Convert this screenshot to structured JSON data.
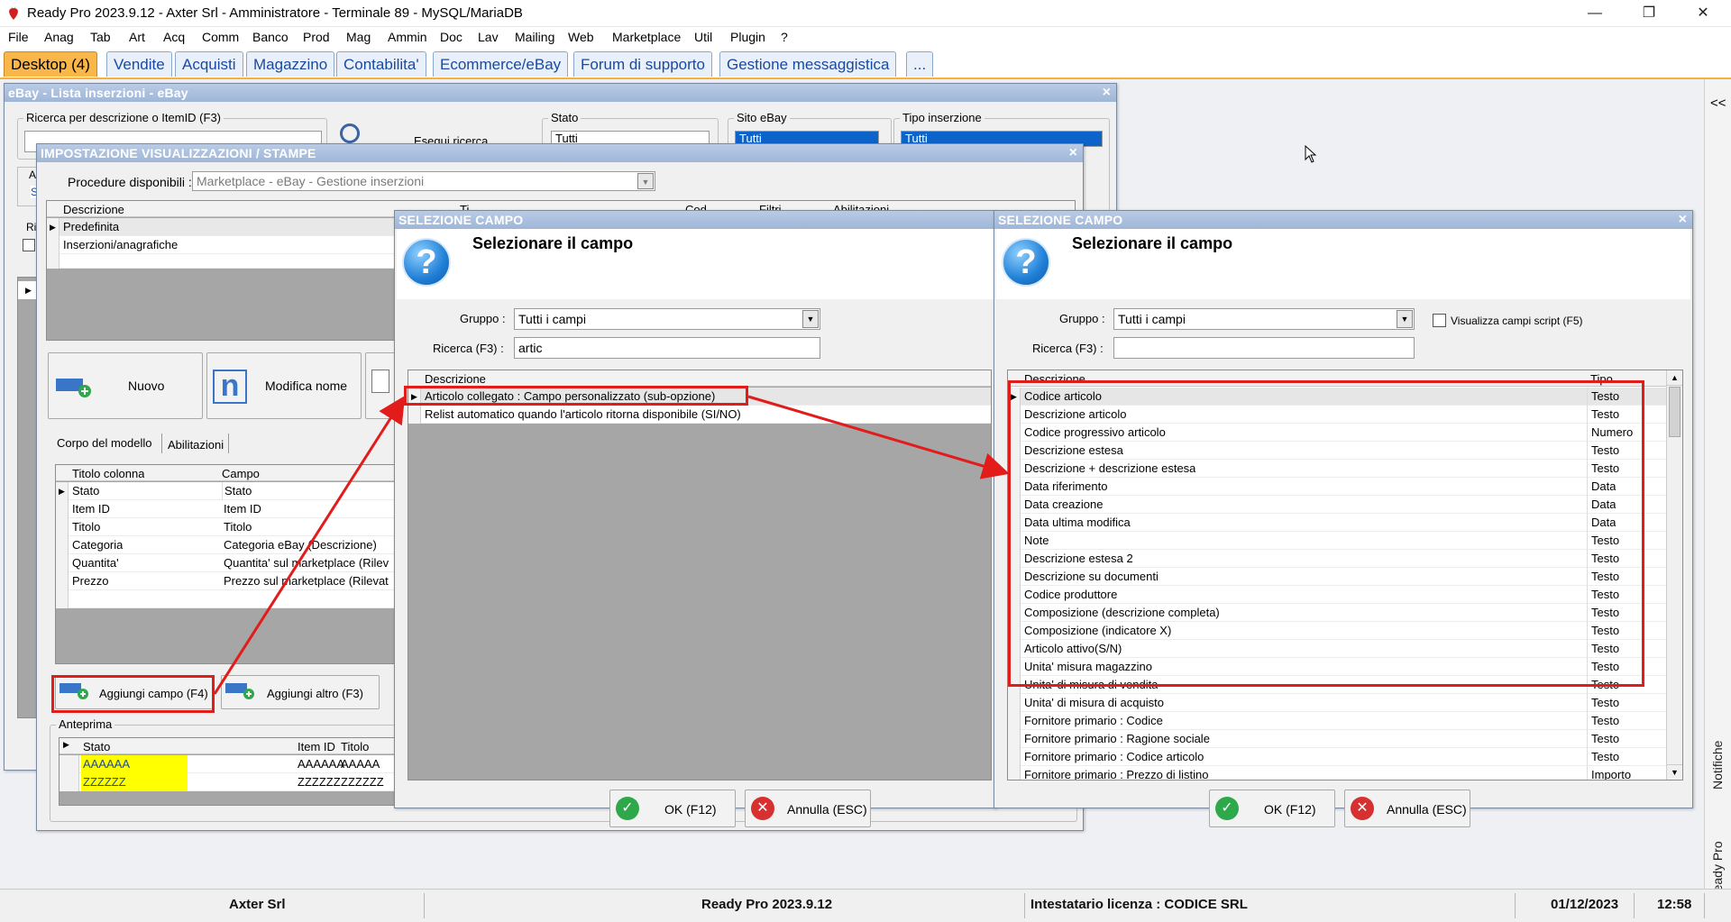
{
  "app": {
    "title": "Ready Pro 2023.9.12 - Axter Srl - Amministratore - Terminale 89 - MySQL/MariaDB",
    "controls": {
      "minimize": "—",
      "restore": "❐",
      "close": "✕"
    }
  },
  "menu": [
    "File",
    "Anag",
    "Tab",
    "Art",
    "Acq",
    "Comm",
    "Banco",
    "Prod",
    "Mag",
    "Ammin",
    "Doc",
    "Lav",
    "Mailing",
    "Web",
    "Marketplace",
    "Util",
    "Plugin",
    "?"
  ],
  "tabs": [
    "Desktop (4)",
    "Vendite",
    "Acquisti",
    "Magazzino",
    "Contabilita'",
    "Ecommerce/eBay",
    "Forum di supporto",
    "Gestione messaggistica",
    "..."
  ],
  "side_panel": {
    "collapse": "<<",
    "notifiche": "Notifiche",
    "assistente": "Assistente Ready Pro"
  },
  "ebay_window": {
    "title": "eBay - Lista inserzioni - eBay",
    "search_label": "Ricerca per descrizione o ItemID (F3)",
    "search_button": "Esegui ricerca",
    "stato_label": "Stato",
    "stato_value": "Tutti",
    "sito_label": "Sito eBay",
    "sito_value": "Tutti",
    "tipo_label": "Tipo inserzione",
    "tipo_value": "Tutti",
    "fragment_ar": "Ar",
    "fragment_se": "Se",
    "fragment_ric": "Ric"
  },
  "impostazione_window": {
    "title": "IMPOSTAZIONE VISUALIZZAZIONI / STAMPE",
    "procedure_label": "Procedure disponibili :",
    "procedure_value": "Marketplace - eBay - Gestione inserzioni",
    "models_header": {
      "descrizione": "Descrizione",
      "tipo": "Ti",
      "col3": "Cod",
      "col4": "Filtri",
      "col5": "Abilitazioni"
    },
    "models": [
      "Predefinita",
      "Inserzioni/anagrafiche"
    ],
    "btn_nuovo": "Nuovo",
    "btn_modifica": "Modifica nome",
    "tab_corpo": "Corpo del modello",
    "tab_abilitazioni": "Abilitazioni",
    "cols_header": {
      "titolo": "Titolo colonna",
      "campo": "Campo"
    },
    "cols": [
      {
        "titolo": "Stato",
        "campo": "Stato"
      },
      {
        "titolo": "Item ID",
        "campo": "Item ID"
      },
      {
        "titolo": "Titolo",
        "campo": "Titolo"
      },
      {
        "titolo": "Categoria",
        "campo": "Categoria eBay (Descrizione)"
      },
      {
        "titolo": "Quantita'",
        "campo": "Quantita' sul marketplace (Rilev"
      },
      {
        "titolo": "Prezzo",
        "campo": "Prezzo sul marketplace (Rilevat"
      }
    ],
    "btn_aggiungi_campo": "Aggiungi campo (F4)",
    "btn_aggiungi_altro": "Aggiungi altro (F3)",
    "anteprima_label": "Anteprima",
    "anteprima_header": {
      "stato": "Stato",
      "itemid": "Item ID",
      "titolo": "Titolo"
    },
    "anteprima_rows": [
      {
        "stato": "AAAAAA",
        "itemid": "AAAAAA",
        "titolo": "AAAAA"
      },
      {
        "stato": "ZZZZZZ",
        "itemid": "ZZZZZZ",
        "titolo": "ZZZZZZ"
      }
    ],
    "highlight_color": "#ffff00"
  },
  "selezione1": {
    "title": "SELEZIONE CAMPO",
    "heading": "Selezionare il campo",
    "gruppo_label": "Gruppo :",
    "gruppo_value": "Tutti i campi",
    "ricerca_label": "Ricerca (F3) :",
    "ricerca_value": "artic",
    "header": "Descrizione",
    "rows": [
      "Articolo collegato : Campo personalizzato (sub-opzione)",
      "Relist automatico quando l'articolo ritorna disponibile (SI/NO)"
    ],
    "ok": "OK (F12)",
    "annulla": "Annulla (ESC)"
  },
  "selezione2": {
    "title": "SELEZIONE CAMPO",
    "heading": "Selezionare il campo",
    "gruppo_label": "Gruppo :",
    "gruppo_value": "Tutti i campi",
    "script_checkbox": "Visualizza campi script (F5)",
    "ricerca_label": "Ricerca (F3) :",
    "ricerca_value": "",
    "header": {
      "descrizione": "Descrizione",
      "tipo": "Tipo"
    },
    "rows": [
      {
        "d": "Codice articolo",
        "t": "Testo"
      },
      {
        "d": "Descrizione articolo",
        "t": "Testo"
      },
      {
        "d": "Codice progressivo articolo",
        "t": "Numero"
      },
      {
        "d": "Descrizione estesa",
        "t": "Testo"
      },
      {
        "d": "Descrizione + descrizione estesa",
        "t": "Testo"
      },
      {
        "d": "Data riferimento",
        "t": "Data"
      },
      {
        "d": "Data creazione",
        "t": "Data"
      },
      {
        "d": "Data ultima modifica",
        "t": "Data"
      },
      {
        "d": "Note",
        "t": "Testo"
      },
      {
        "d": "Descrizione estesa 2",
        "t": "Testo"
      },
      {
        "d": "Descrizione su documenti",
        "t": "Testo"
      },
      {
        "d": "Codice produttore",
        "t": "Testo"
      },
      {
        "d": "Composizione (descrizione completa)",
        "t": "Testo"
      },
      {
        "d": "Composizione (indicatore X)",
        "t": "Testo"
      },
      {
        "d": "Articolo attivo(S/N)",
        "t": "Testo"
      },
      {
        "d": "Unita' misura magazzino",
        "t": "Testo"
      },
      {
        "d": "Unita' di misura di vendita",
        "t": "Testo"
      },
      {
        "d": "Unita' di misura di acquisto",
        "t": "Testo"
      },
      {
        "d": "Fornitore primario : Codice",
        "t": "Testo"
      },
      {
        "d": "Fornitore primario : Ragione sociale",
        "t": "Testo"
      },
      {
        "d": "Fornitore primario : Codice articolo",
        "t": "Testo"
      },
      {
        "d": "Fornitore primario : Prezzo di listino",
        "t": "Importo"
      }
    ],
    "ok": "OK (F12)",
    "annulla": "Annulla (ESC)"
  },
  "status": {
    "company": "Axter Srl",
    "version": "Ready Pro 2023.9.12",
    "license": "Intestatario licenza : CODICE SRL",
    "date": "01/12/2023",
    "time": "12:58"
  },
  "colors": {
    "accent": "#f9b74a",
    "annotation": "#e21b1b",
    "selected_row": "#dcdcdc"
  }
}
